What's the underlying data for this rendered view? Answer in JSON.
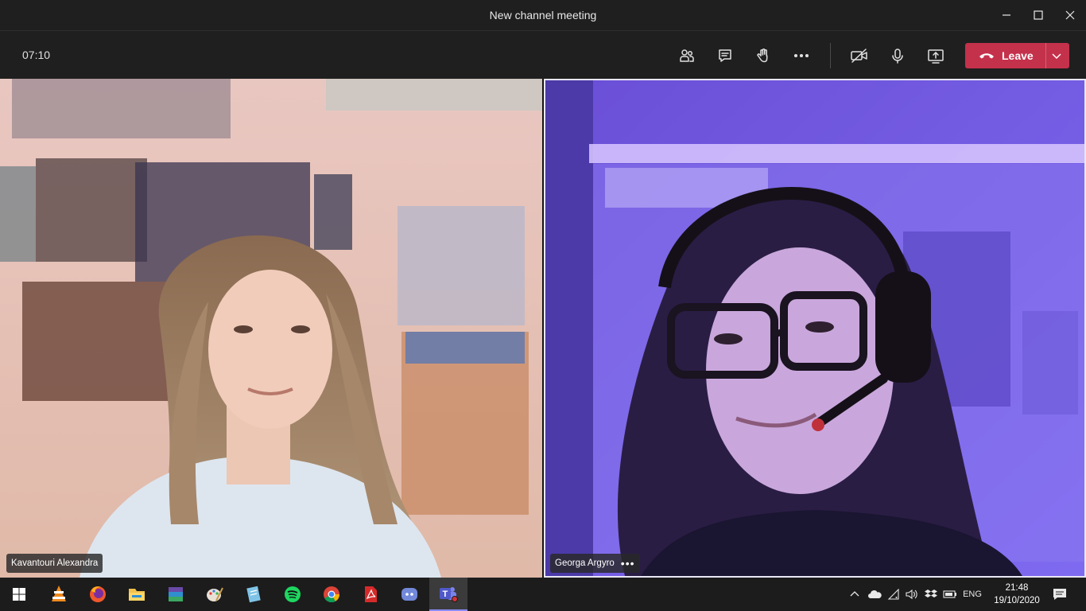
{
  "window": {
    "title": "New channel meeting"
  },
  "meeting": {
    "timer": "07:10",
    "leave_label": "Leave"
  },
  "participants": [
    {
      "name": "Kavantouri Alexandra"
    },
    {
      "name": "Georga Argyro",
      "more": "•••"
    }
  ],
  "icons": {
    "controls": [
      "people-icon",
      "chat-icon",
      "raise-hand-icon",
      "more-options-icon",
      "camera-off-icon",
      "microphone-icon",
      "share-screen-icon",
      "phone-hangup-icon",
      "chevron-down-icon"
    ],
    "taskbar": [
      "windows-start-icon",
      "vlc-icon",
      "firefox-icon",
      "file-explorer-icon",
      "winrar-icon",
      "paint-icon",
      "notepad-icon",
      "spotify-icon",
      "chrome-icon",
      "acrobat-icon",
      "discord-icon",
      "teams-icon"
    ],
    "tray": [
      "chevron-up-icon",
      "onedrive-icon",
      "wifi-icon",
      "volume-icon",
      "dropbox-icon",
      "battery-icon",
      "notification-icon"
    ]
  },
  "colors": {
    "leave": "#c4314b",
    "active_speaker_border": "#e9e6f5"
  },
  "taskbar": {
    "language": "ENG",
    "time": "21:48",
    "date": "19/10/2020"
  }
}
